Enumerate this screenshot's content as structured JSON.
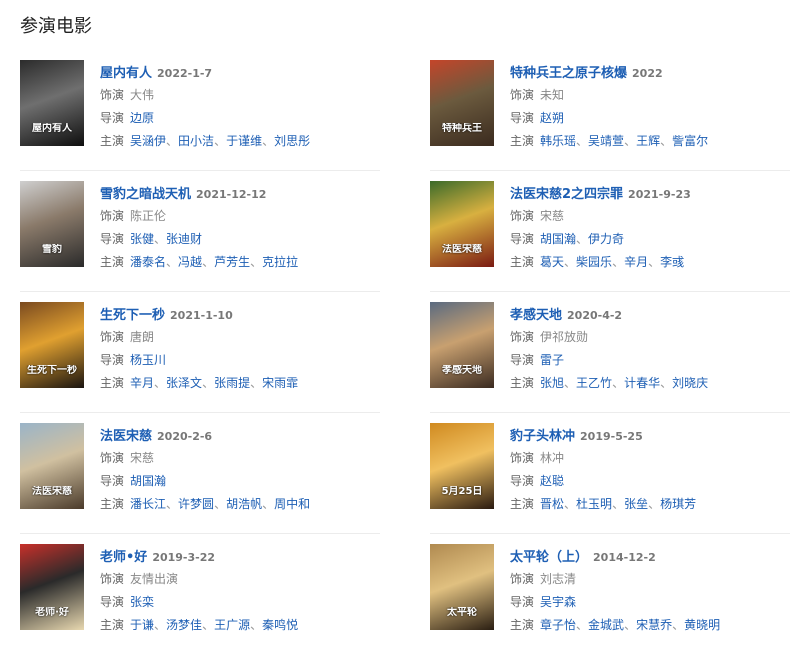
{
  "section": {
    "title": "参演电影"
  },
  "labels": {
    "role": "饰演",
    "director": "导演",
    "cast": "主演"
  },
  "movies": [
    {
      "title": "屋内有人",
      "date": "2022-1-7",
      "role": "大伟",
      "directors": [
        "边原"
      ],
      "cast": [
        "吴涵伊",
        "田小洁",
        "于谨维",
        "刘思彤"
      ],
      "poster": {
        "bg1": "#2b2b2b",
        "bg2": "#0e0e0e",
        "accent": "#6f6f6f",
        "text": "屋内有人"
      }
    },
    {
      "title": "特种兵王之原子核爆",
      "date": "2022",
      "role": "未知",
      "directors": [
        "赵朔"
      ],
      "cast": [
        "韩乐瑶",
        "吴靖萱",
        "王辉",
        "訾富尔"
      ],
      "poster": {
        "bg1": "#c4452a",
        "bg2": "#3a2a1e",
        "accent": "#6b5a3e",
        "text": "特种兵王"
      }
    },
    {
      "title": "雪豹之暗战天机",
      "date": "2021-12-12",
      "role": "陈正伦",
      "directors": [
        "张健",
        "张迪财"
      ],
      "cast": [
        "潘泰名",
        "冯越",
        "芦芳生",
        "克拉拉"
      ],
      "poster": {
        "bg1": "#cfcfcf",
        "bg2": "#2a2a2a",
        "accent": "#8a7a6a",
        "text": "雪豹"
      }
    },
    {
      "title": "法医宋慈2之四宗罪",
      "date": "2021-9-23",
      "role": "宋慈",
      "directors": [
        "胡国瀚",
        "伊力奇"
      ],
      "cast": [
        "葛天",
        "柴园乐",
        "辛月",
        "李彧"
      ],
      "poster": {
        "bg1": "#3b6b2a",
        "bg2": "#7a1a12",
        "accent": "#d8b040",
        "text": "法医宋慈"
      }
    },
    {
      "title": "生死下一秒",
      "date": "2021-1-10",
      "role": "唐朗",
      "directors": [
        "杨玉川"
      ],
      "cast": [
        "辛月",
        "张泽文",
        "张雨提",
        "宋雨霏"
      ],
      "poster": {
        "bg1": "#7a4a20",
        "bg2": "#1a1410",
        "accent": "#e0a030",
        "text": "生死下一秒"
      }
    },
    {
      "title": "孝感天地",
      "date": "2020-4-2",
      "role": "伊祁放勋",
      "directors": [
        "雷子"
      ],
      "cast": [
        "张旭",
        "王乙竹",
        "计春华",
        "刘晓庆"
      ],
      "poster": {
        "bg1": "#5a6a80",
        "bg2": "#3a2a20",
        "accent": "#c8a070",
        "text": "孝感天地"
      }
    },
    {
      "title": "法医宋慈",
      "date": "2020-2-6",
      "role": "宋慈",
      "directors": [
        "胡国瀚"
      ],
      "cast": [
        "潘长江",
        "许梦圆",
        "胡浩帆",
        "周中和"
      ],
      "poster": {
        "bg1": "#9ab4c8",
        "bg2": "#4a3a2a",
        "accent": "#d0c0a0",
        "text": "法医宋慈"
      }
    },
    {
      "title": "豹子头林冲",
      "date": "2019-5-25",
      "role": "林冲",
      "directors": [
        "赵聪"
      ],
      "cast": [
        "晋松",
        "杜玉明",
        "张垒",
        "杨琪芳"
      ],
      "poster": {
        "bg1": "#d08a20",
        "bg2": "#2a1a10",
        "accent": "#f0c060",
        "text": "5月25日"
      }
    },
    {
      "title": "老师•好",
      "date": "2019-3-22",
      "role": "友情出演",
      "directors": [
        "张栾"
      ],
      "cast": [
        "于谦",
        "汤梦佳",
        "王广源",
        "秦鸣悦"
      ],
      "poster": {
        "bg1": "#c8302a",
        "bg2": "#e8d8b0",
        "accent": "#2a2a2a",
        "text": "老师·好"
      }
    },
    {
      "title": "太平轮（上）",
      "date": "2014-12-2",
      "role": "刘志清",
      "directors": [
        "吴宇森"
      ],
      "cast": [
        "章子怡",
        "金城武",
        "宋慧乔",
        "黄晓明"
      ],
      "poster": {
        "bg1": "#b08a50",
        "bg2": "#2a1e12",
        "accent": "#e0c080",
        "text": "太平轮"
      }
    }
  ]
}
